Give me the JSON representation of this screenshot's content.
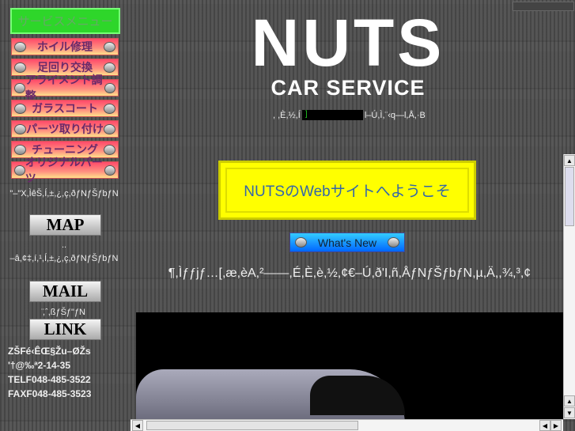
{
  "sidebar": {
    "service_menu": "サービスメニュー",
    "items": [
      "ホイル修理",
      "足回り交換",
      "アライメント調整",
      "ガラスコート",
      "パーツ取り付け",
      "チューニング",
      "オリジナルパーツ"
    ],
    "map_caption": "\"–\"X,ÌêŠ,Í,±,¿,ç,ðƒNƒŠƒbƒN",
    "map_label": "MAP",
    "mail_caption_1": "..",
    "mail_caption_2": "–â,¢‡,í,¹,Í,±,¿,ç,ðƒNƒŠƒbƒN",
    "mail_label": "MAIL",
    "link_caption": "̈,ˆ,ßƒŠƒ\"ƒN",
    "link_label": "LINK",
    "address": [
      "ZŠFé‹ÊŒ§Žu–ØŽs",
      "'†@‰ª2-14-35",
      "TELF048-485-3522",
      "FAXF048-485-3523"
    ]
  },
  "header": {
    "logo_text": "NUTS",
    "logo_sub": "CAR SERVICE",
    "tagline_pre": ", ,È,½,Í",
    "tagline_box": "]",
    "tagline_post": "l–Ú,Ì,¨‹q—l,Å,·B"
  },
  "banner": {
    "text": "NUTSのWebサイトへようこそ"
  },
  "whats_new": {
    "label": "What's New"
  },
  "message": "¶,Ìƒƒjƒ…[,æ,èA,²——,É,È,è,½,¢€–Ú,ð'I,ñ,ÅƒNƒŠƒbƒN,µ,Ä,,¾,³,¢"
}
